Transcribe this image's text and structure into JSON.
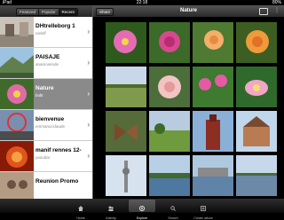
{
  "status_bar": {
    "carrier": "iPad",
    "time": "22:18",
    "battery": "80%"
  },
  "left_panel": {
    "segments": [
      "Featured",
      "Popular",
      "Recent"
    ],
    "selected_segment": "Recent",
    "items": [
      {
        "title": "DHtrelleborg 1",
        "subtitle": "nielsff",
        "selected": false
      },
      {
        "title": "PAISAJE",
        "subtitle": "anamosende",
        "selected": false
      },
      {
        "title": "Nature",
        "subtitle": "boltr",
        "selected": true
      },
      {
        "title": "bienvenue",
        "subtitle": "emmanucclaude",
        "selected": false
      },
      {
        "title": "manif rennes 12-...",
        "subtitle": "yaoudar",
        "selected": false
      },
      {
        "title": "Reunion Promo",
        "subtitle": "",
        "selected": false
      }
    ]
  },
  "main": {
    "share_label": "Share",
    "title": "Nature",
    "photos": [
      {
        "theme": "pink-flower"
      },
      {
        "theme": "pink-rose"
      },
      {
        "theme": "garden-rose"
      },
      {
        "theme": "orange-rose"
      },
      {
        "theme": "field"
      },
      {
        "theme": "pale-rose"
      },
      {
        "theme": "pink-flower-2"
      },
      {
        "theme": "lotus"
      },
      {
        "theme": "butterfly"
      },
      {
        "theme": "park"
      },
      {
        "theme": "red-tower"
      },
      {
        "theme": "castle"
      },
      {
        "theme": "tv-tower"
      },
      {
        "theme": "lake"
      },
      {
        "theme": "harbor"
      },
      {
        "theme": "shore"
      }
    ]
  },
  "tab_bar": {
    "tabs": [
      {
        "label": "Home",
        "icon": "home-icon"
      },
      {
        "label": "Activity",
        "icon": "activity-icon"
      },
      {
        "label": "Explore",
        "icon": "explore-icon",
        "active": true
      },
      {
        "label": "Search",
        "icon": "search-icon"
      },
      {
        "label": "Create album",
        "icon": "create-album-icon"
      }
    ]
  }
}
